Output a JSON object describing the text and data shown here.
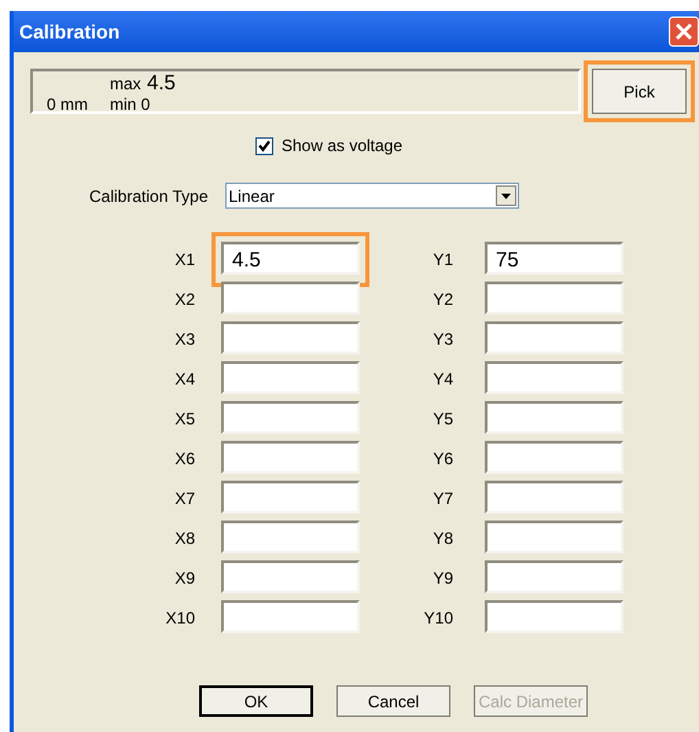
{
  "window": {
    "title": "Calibration"
  },
  "reading": {
    "max_label": "max",
    "max_value": "4.5",
    "position": "0 mm",
    "min_label": "min 0"
  },
  "pick_button": {
    "label": "Pick",
    "highlighted": true
  },
  "show_as_voltage": {
    "label": "Show as voltage",
    "checked": true
  },
  "calibration_type": {
    "label": "Calibration Type",
    "value": "Linear"
  },
  "points": [
    {
      "x_label": "X1",
      "x_value": "4.5",
      "x_highlighted": true,
      "y_label": "Y1",
      "y_value": "75"
    },
    {
      "x_label": "X2",
      "y_label": "Y2"
    },
    {
      "x_label": "X3",
      "y_label": "Y3"
    },
    {
      "x_label": "X4",
      "y_label": "Y4"
    },
    {
      "x_label": "X5",
      "y_label": "Y5"
    },
    {
      "x_label": "X6",
      "y_label": "Y6"
    },
    {
      "x_label": "X7",
      "y_label": "Y7"
    },
    {
      "x_label": "X8",
      "y_label": "Y8"
    },
    {
      "x_label": "X9",
      "y_label": "Y9"
    },
    {
      "x_label": "X10",
      "y_label": "Y10"
    }
  ],
  "buttons": [
    {
      "label": "OK",
      "default": true,
      "disabled": false
    },
    {
      "label": "Cancel",
      "default": false,
      "disabled": false
    },
    {
      "label": "Calc Diameter",
      "default": false,
      "disabled": true
    }
  ]
}
